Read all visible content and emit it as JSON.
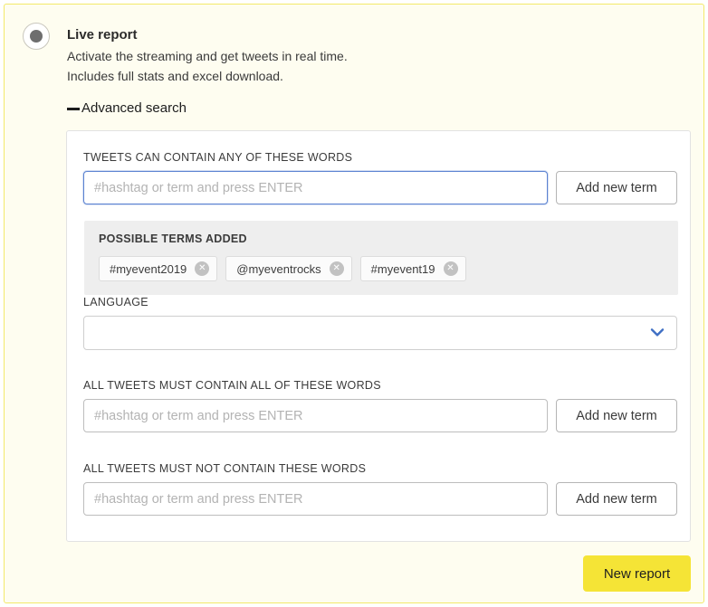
{
  "option": {
    "title": "Live report",
    "desc_line1": "Activate the streaming and get tweets in real time.",
    "desc_line2": "Includes full stats and excel download.",
    "radio_selected": true
  },
  "advanced_search": {
    "toggle_label": "Advanced search",
    "toggle_icon": "minus-icon",
    "expanded": true
  },
  "sections": {
    "any_words": {
      "label": "TWEETS CAN CONTAIN ANY OF THESE WORDS",
      "input_value": "",
      "input_placeholder": "#hashtag or term and press ENTER",
      "input_focused": true,
      "button_label": "Add new term"
    },
    "possible_terms": {
      "title": "POSSIBLE TERMS ADDED",
      "terms": [
        {
          "label": "#myevent2019",
          "remove_icon": "close-icon"
        },
        {
          "label": "@myeventrocks",
          "remove_icon": "close-icon"
        },
        {
          "label": "#myevent19",
          "remove_icon": "close-icon"
        }
      ]
    },
    "language": {
      "label": "LANGUAGE",
      "selected_value": "",
      "chevron_icon": "chevron-down-icon"
    },
    "all_words": {
      "label": "ALL TWEETS MUST CONTAIN ALL OF THESE WORDS",
      "input_value": "",
      "input_placeholder": "#hashtag or term and press ENTER",
      "button_label": "Add new term"
    },
    "none_words": {
      "label": "ALL TWEETS MUST NOT CONTAIN THESE WORDS",
      "input_value": "",
      "input_placeholder": "#hashtag or term and press ENTER",
      "button_label": "Add new term"
    }
  },
  "footer": {
    "new_report_label": "New report"
  },
  "colors": {
    "panel_border": "#f2e96a",
    "panel_bg": "#fefdf0",
    "accent_button": "#f5e436",
    "focus_border": "#5b82d1",
    "chevron": "#3f6fc4",
    "terms_panel_bg": "#eeeeee"
  }
}
